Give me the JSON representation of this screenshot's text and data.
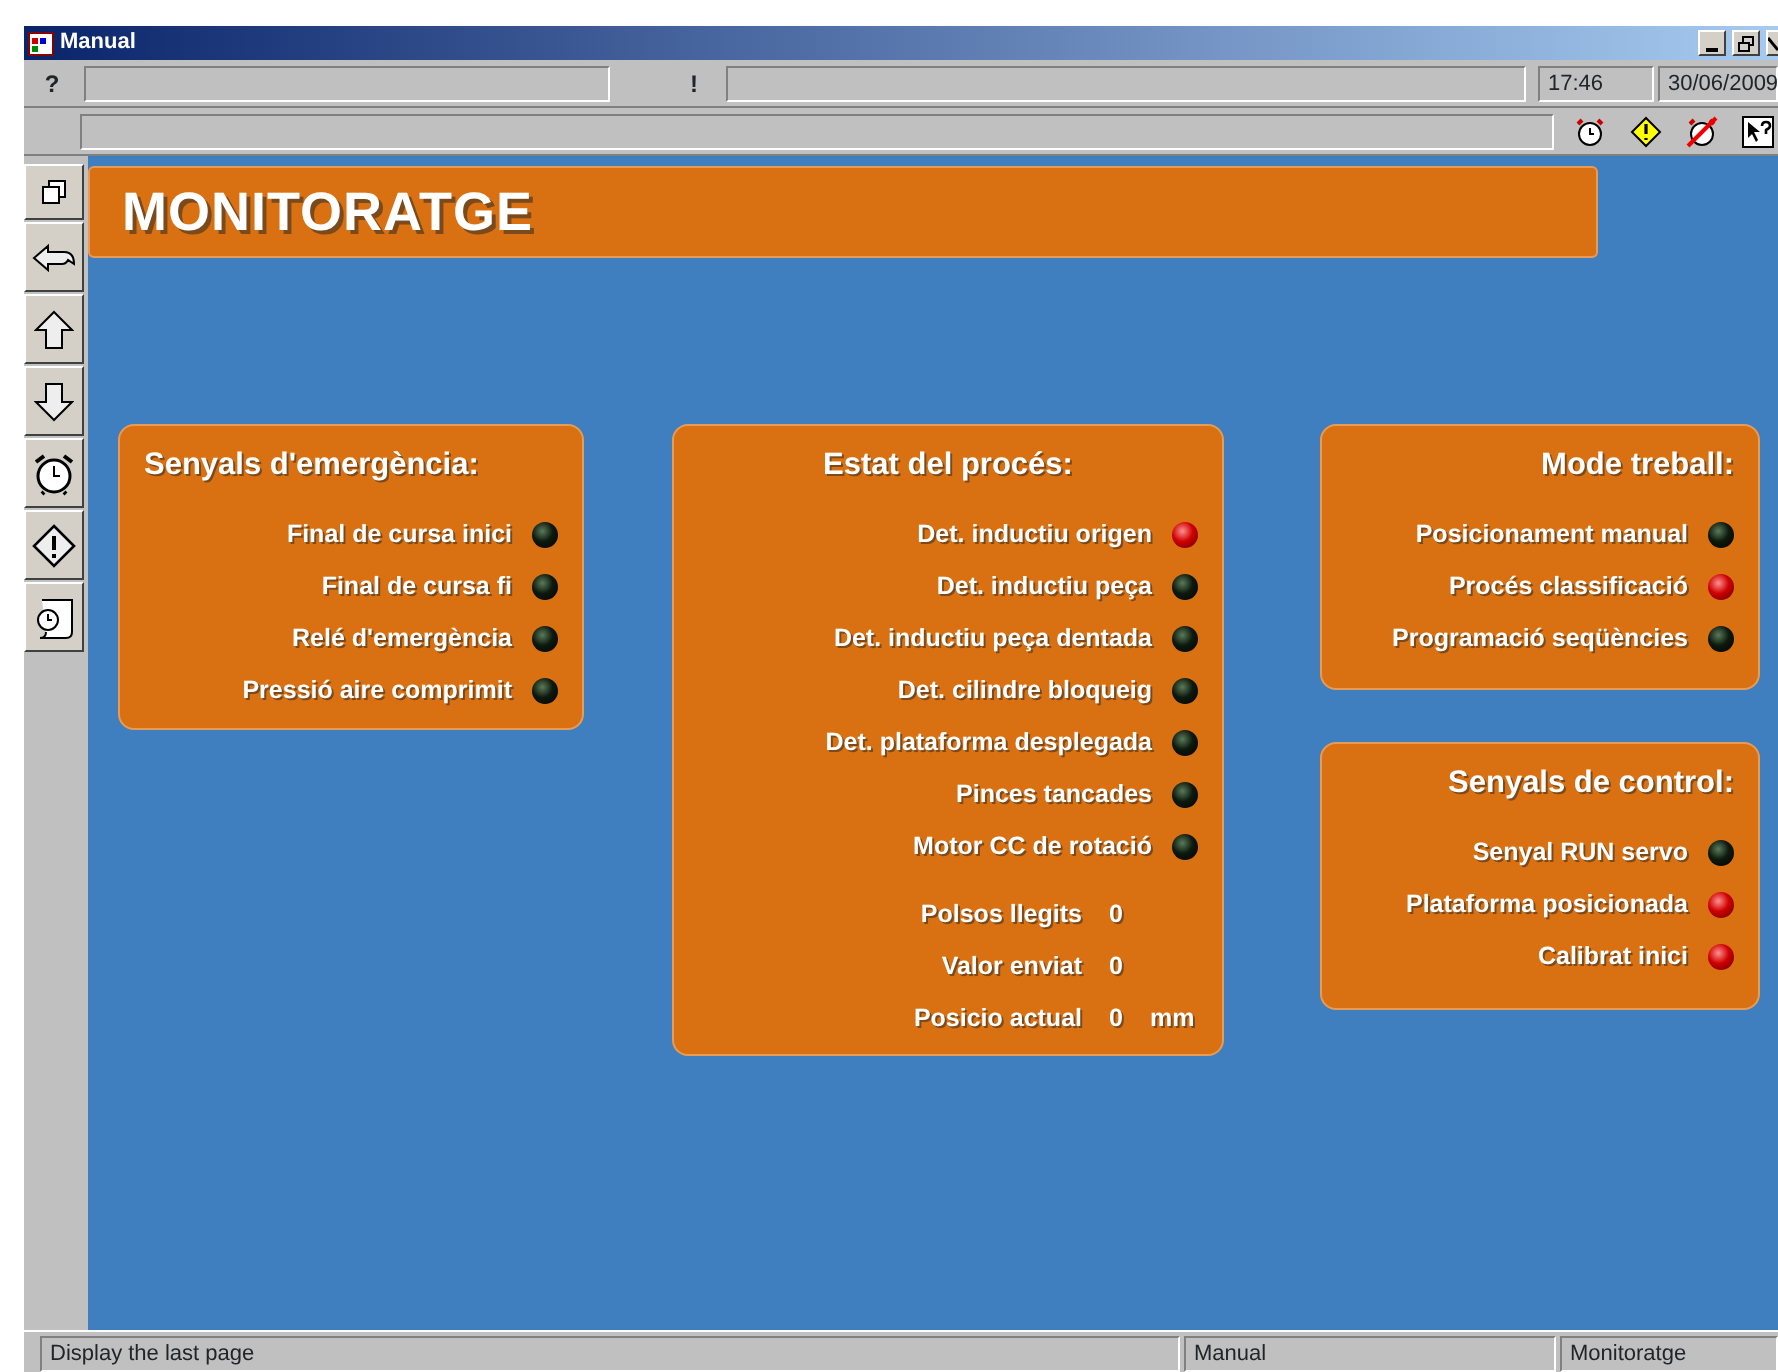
{
  "window": {
    "title": "Manual"
  },
  "toolbar": {
    "help_symbol": "?",
    "alert_symbol": "!",
    "time": "17:46",
    "date": "30/06/2009"
  },
  "header": {
    "title": "MONITORATGE"
  },
  "panels": [
    {
      "title": "Senyals d'emergència:",
      "lamps": [
        {
          "label": "Final de cursa inici",
          "on": false
        },
        {
          "label": "Final de cursa fi",
          "on": false
        },
        {
          "label": "Relé d'emergència",
          "on": false
        },
        {
          "label": "Pressió aire comprimit",
          "on": false
        }
      ]
    },
    {
      "title": "Estat del procés:",
      "lamps": [
        {
          "label": "Det. inductiu origen",
          "on": true
        },
        {
          "label": "Det. inductiu peça",
          "on": false
        },
        {
          "label": "Det. inductiu peça dentada",
          "on": false
        },
        {
          "label": "Det. cilindre bloqueig",
          "on": false
        },
        {
          "label": "Det. plataforma desplegada",
          "on": false
        },
        {
          "label": "Pinces tancades",
          "on": false
        },
        {
          "label": "Motor CC de rotació",
          "on": false
        }
      ],
      "values": [
        {
          "label": "Polsos llegits",
          "value": "0"
        },
        {
          "label": "Valor enviat",
          "value": "0"
        },
        {
          "label": "Posicio actual",
          "value": "0",
          "unit": "mm"
        }
      ]
    },
    {
      "title": "Mode treball:",
      "lamps": [
        {
          "label": "Posicionament manual",
          "on": false
        },
        {
          "label": "Procés classificació",
          "on": true
        },
        {
          "label": "Programació seqüències",
          "on": false
        }
      ]
    },
    {
      "title": "Senyals de control:",
      "lamps": [
        {
          "label": "Senyal RUN servo",
          "on": false
        },
        {
          "label": "Plataforma posicionada",
          "on": true
        },
        {
          "label": "Calibrat inici",
          "on": true
        }
      ]
    }
  ],
  "status_bar": [
    "Display the last page",
    "Manual",
    "Monitoratge"
  ]
}
